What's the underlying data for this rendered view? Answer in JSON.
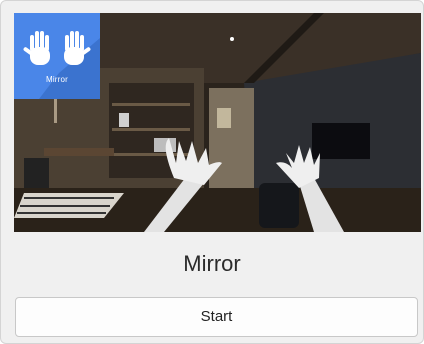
{
  "card": {
    "title": "Mirror",
    "start_label": "Start",
    "badge": {
      "label": "Mirror",
      "icon": "hands-icon",
      "color": "#4a86e8"
    },
    "thumbnail": {
      "description_icon": "vr-hands-icon"
    }
  }
}
